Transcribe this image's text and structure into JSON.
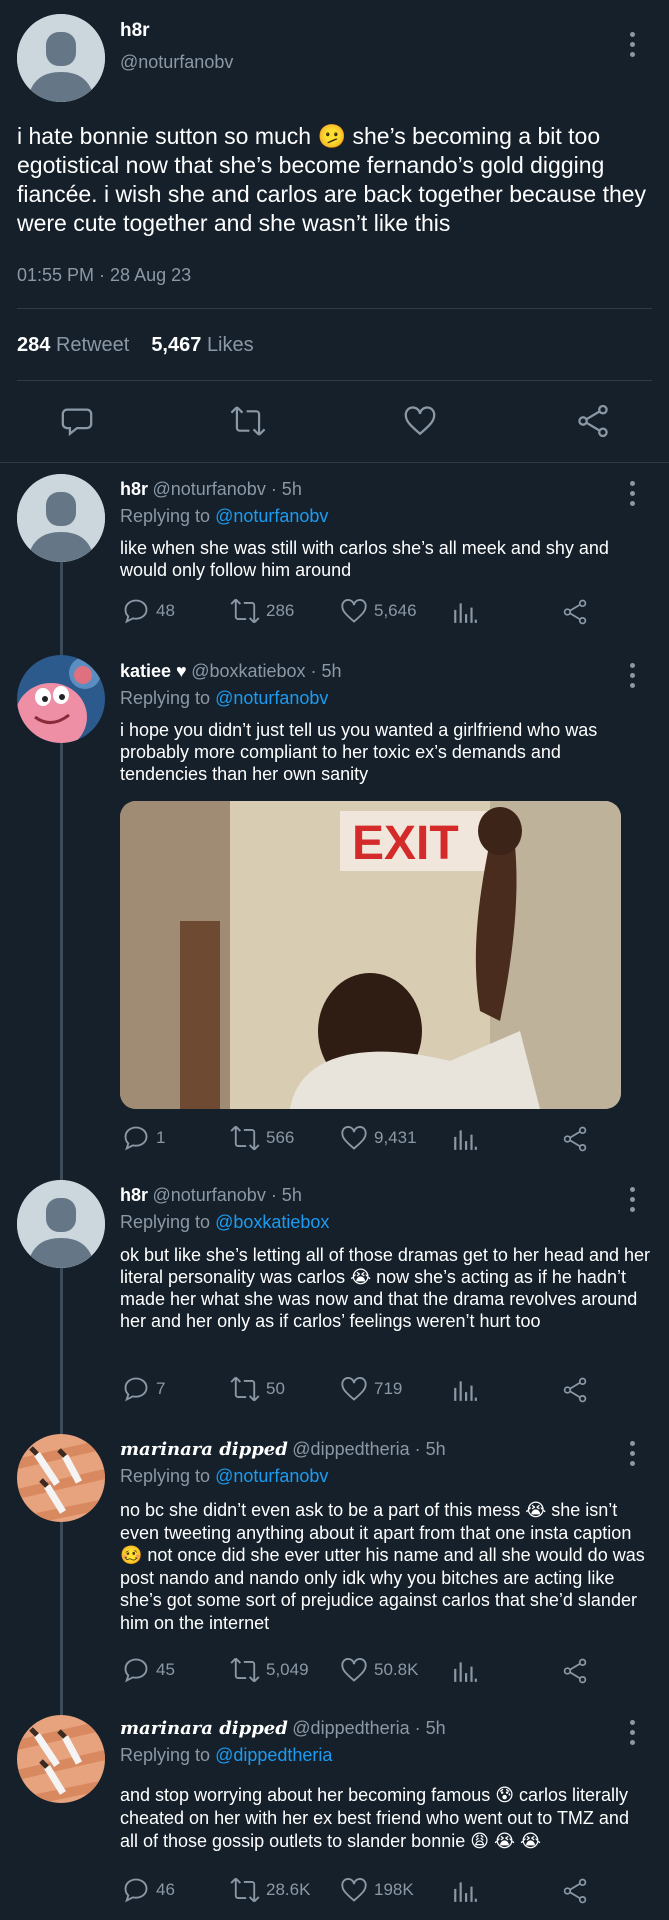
{
  "main_tweet": {
    "name": "h8r",
    "handle": "@noturfanobv",
    "text": "i hate bonnie sutton so much 🫤 she’s becoming a bit too egotistical now that she’s become fernando’s gold digging fiancée. i wish she and carlos are back together because they were cute together and she wasn’t like this",
    "timestamp": "01:55 PM · 28 Aug 23",
    "retweets_count": "284",
    "retweets_label": "Retweet",
    "likes_count": "5,467",
    "likes_label": "Likes"
  },
  "replies": [
    {
      "name": "h8r",
      "handle": "@noturfanobv · 5h",
      "replying_label": "Replying to",
      "replying_to": "@noturfanobv",
      "text": "like when she was still with carlos she’s all meek and shy and would only follow him around",
      "replies": "48",
      "retweets": "286",
      "likes": "5,646"
    },
    {
      "name": "katiee ♥",
      "handle": "@boxkatiebox · 5h",
      "replying_label": "Replying to",
      "replying_to": "@noturfanobv",
      "text": "i hope you didn’t just tell us you wanted a girlfriend who was probably more compliant to her toxic ex’s demands and tendencies than her own sanity",
      "image_sign": "EXIT",
      "replies": "1",
      "retweets": "566",
      "likes": "9,431"
    },
    {
      "name": "h8r",
      "handle": "@noturfanobv · 5h",
      "replying_label": "Replying to",
      "replying_to": "@boxkatiebox",
      "text": "ok but like she’s letting all of those dramas get to her head and her literal personality was carlos 😭 now she’s acting as if he hadn’t made her what she was now and that the drama revolves around her and her only as if carlos’ feelings weren’t hurt too",
      "replies": "7",
      "retweets": "50",
      "likes": "719"
    },
    {
      "name": "marinara dipped",
      "handle": "@dippedtheria · 5h",
      "replying_label": "Replying to",
      "replying_to": "@noturfanobv",
      "text": "no bc she didn’t even ask to be a part of this mess 😭 she isn’t even tweeting anything about it apart from that one insta caption 🥴 not once did she ever utter his name and all she would do was post nando and nando only idk why you bitches are acting like she’s got some sort of prejudice against carlos that she’d slander him on the internet",
      "replies": "45",
      "retweets": "5,049",
      "likes": "50.8K"
    },
    {
      "name": "marinara dipped",
      "handle": "@dippedtheria · 5h",
      "replying_label": "Replying to",
      "replying_to": "@dippedtheria",
      "text": "and stop worrying about her becoming famous 😰 carlos literally cheated on her with her ex best friend who went out to TMZ and all of those gossip outlets to slander bonnie 😩 😭 😭",
      "replies": "46",
      "retweets": "28.6K",
      "likes": "198K"
    }
  ],
  "colors": {
    "background": "#15202b",
    "link": "#1d9bf0",
    "muted": "#8b98a5",
    "divider": "#2f3b47"
  },
  "icons": [
    "more-icon",
    "reply-icon",
    "retweet-icon",
    "like-icon",
    "share-icon",
    "analytics-icon"
  ]
}
